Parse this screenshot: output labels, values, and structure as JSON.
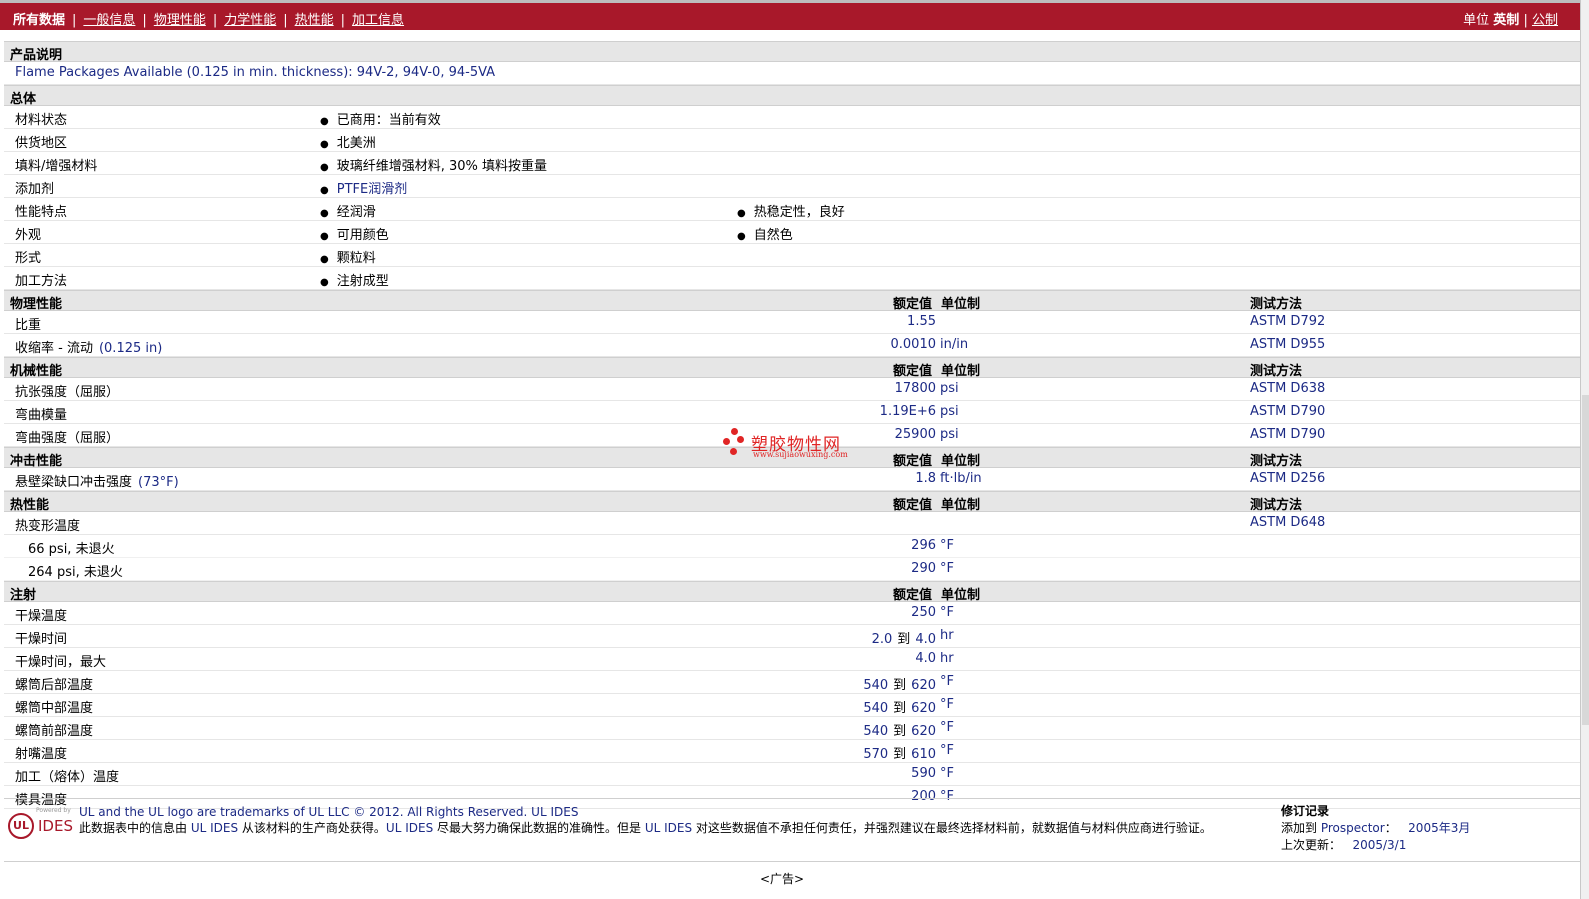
{
  "nav": {
    "current": "所有数据",
    "links": [
      "一般信息",
      "物理性能",
      "力学性能",
      "热性能",
      "加工信息"
    ],
    "sep": "|",
    "units_label": "单位",
    "units_active": "英制",
    "units_other": "公制"
  },
  "sections": {
    "description": {
      "title": "产品说明",
      "text": "Flame Packages Available (0.125 in min. thickness): 94V-2, 94V-0, 94-5VA"
    },
    "general": {
      "title": "总体",
      "rows": [
        {
          "label": "材料状态",
          "b1": "已商用：当前有效",
          "b2": ""
        },
        {
          "label": "供货地区",
          "b1": "北美洲",
          "b2": ""
        },
        {
          "label": "填料/增强材料",
          "b1": "玻璃纤维增强材料, 30% 填料按重量",
          "b2": ""
        },
        {
          "label": "添加剂",
          "b1": "PTFE润滑剂",
          "b2": ""
        },
        {
          "label": "性能特点",
          "b1": "经润滑",
          "b2": "热稳定性，良好"
        },
        {
          "label": "外观",
          "b1": "可用颜色",
          "b2": "自然色"
        },
        {
          "label": "形式",
          "b1": "颗粒料",
          "b2": ""
        },
        {
          "label": "加工方法",
          "b1": "注射成型",
          "b2": ""
        }
      ]
    },
    "headers": {
      "nominal": "额定值",
      "unit": "单位制",
      "method": "测试方法"
    },
    "physical": {
      "title": "物理性能",
      "rows": [
        {
          "label": "比重",
          "value": "1.55",
          "unit": "",
          "method": "ASTM D792"
        },
        {
          "label": "收缩率 - 流动",
          "cond": "(0.125 in)",
          "value": "0.0010",
          "unit": "in/in",
          "method": "ASTM D955"
        }
      ]
    },
    "mechanical": {
      "title": "机械性能",
      "rows": [
        {
          "label": "抗张强度（屈服）",
          "value": "17800",
          "unit": "psi",
          "method": "ASTM D638"
        },
        {
          "label": "弯曲模量",
          "value": "1.19E+6",
          "unit": "psi",
          "method": "ASTM D790"
        },
        {
          "label": "弯曲强度（屈服）",
          "value": "25900",
          "unit": "psi",
          "method": "ASTM D790"
        }
      ]
    },
    "impact": {
      "title": "冲击性能",
      "rows": [
        {
          "label": "悬壁梁缺口冲击强度",
          "cond": "(73°F)",
          "value": "1.8",
          "unit": "ft·lb/in",
          "method": "ASTM D256"
        }
      ]
    },
    "thermal": {
      "title": "热性能",
      "parent": {
        "label": "热变形温度",
        "method": "ASTM D648"
      },
      "rows": [
        {
          "label": "66 psi, 未退火",
          "value": "296",
          "unit": "°F"
        },
        {
          "label": "264 psi, 未退火",
          "value": "290",
          "unit": "°F"
        }
      ]
    },
    "injection": {
      "title": "注射",
      "to": "到",
      "rows": [
        {
          "label": "干燥温度",
          "lo": "",
          "hi": "250",
          "unit": "°F"
        },
        {
          "label": "干燥时间",
          "lo": "2.0",
          "hi": "4.0",
          "unit": "hr"
        },
        {
          "label": "干燥时间，最大",
          "lo": "",
          "hi": "4.0",
          "unit": "hr"
        },
        {
          "label": "螺筒后部温度",
          "lo": "540",
          "hi": "620",
          "unit": "°F"
        },
        {
          "label": "螺筒中部温度",
          "lo": "540",
          "hi": "620",
          "unit": "°F"
        },
        {
          "label": "螺筒前部温度",
          "lo": "540",
          "hi": "620",
          "unit": "°F"
        },
        {
          "label": "射嘴温度",
          "lo": "570",
          "hi": "610",
          "unit": "°F"
        },
        {
          "label": "加工（熔体）温度",
          "lo": "",
          "hi": "590",
          "unit": "°F"
        },
        {
          "label": "模具温度",
          "lo": "",
          "hi": "200",
          "unit": "°F"
        }
      ]
    }
  },
  "watermark": {
    "name": "塑胶物性网",
    "url": "www.sujiaowuxing.com"
  },
  "footer": {
    "logo_powered": "Powered by",
    "logo_ul": "UL",
    "logo_ides": "IDES",
    "line1_a": "UL and the UL logo are trademarks of UL LLC © 2012. All Rights Reserved. ",
    "line1_b": "UL IDES",
    "line2_a": "此数据表中的信息由 ",
    "line2_b": "UL IDES",
    "line2_c": " 从该材料的生产商处获得。",
    "line2_d": "UL IDES",
    "line2_e": " 尽最大努力确保此数据的准确性。但是 ",
    "line2_f": "UL IDES",
    "line2_g": " 对这些数据值不承担任何责任，并强烈建议在最终选择材料前，就数据值与材料供应商进行验证。",
    "rev_title": "修订记录",
    "rev_added_label": "添加到 ",
    "rev_added_link": "Prospector",
    "rev_added_sep": "：",
    "rev_added_date": "2005年3月",
    "rev_updated_label": "上次更新：",
    "rev_updated_date": "2005/3/1"
  },
  "ad": "<广告>"
}
